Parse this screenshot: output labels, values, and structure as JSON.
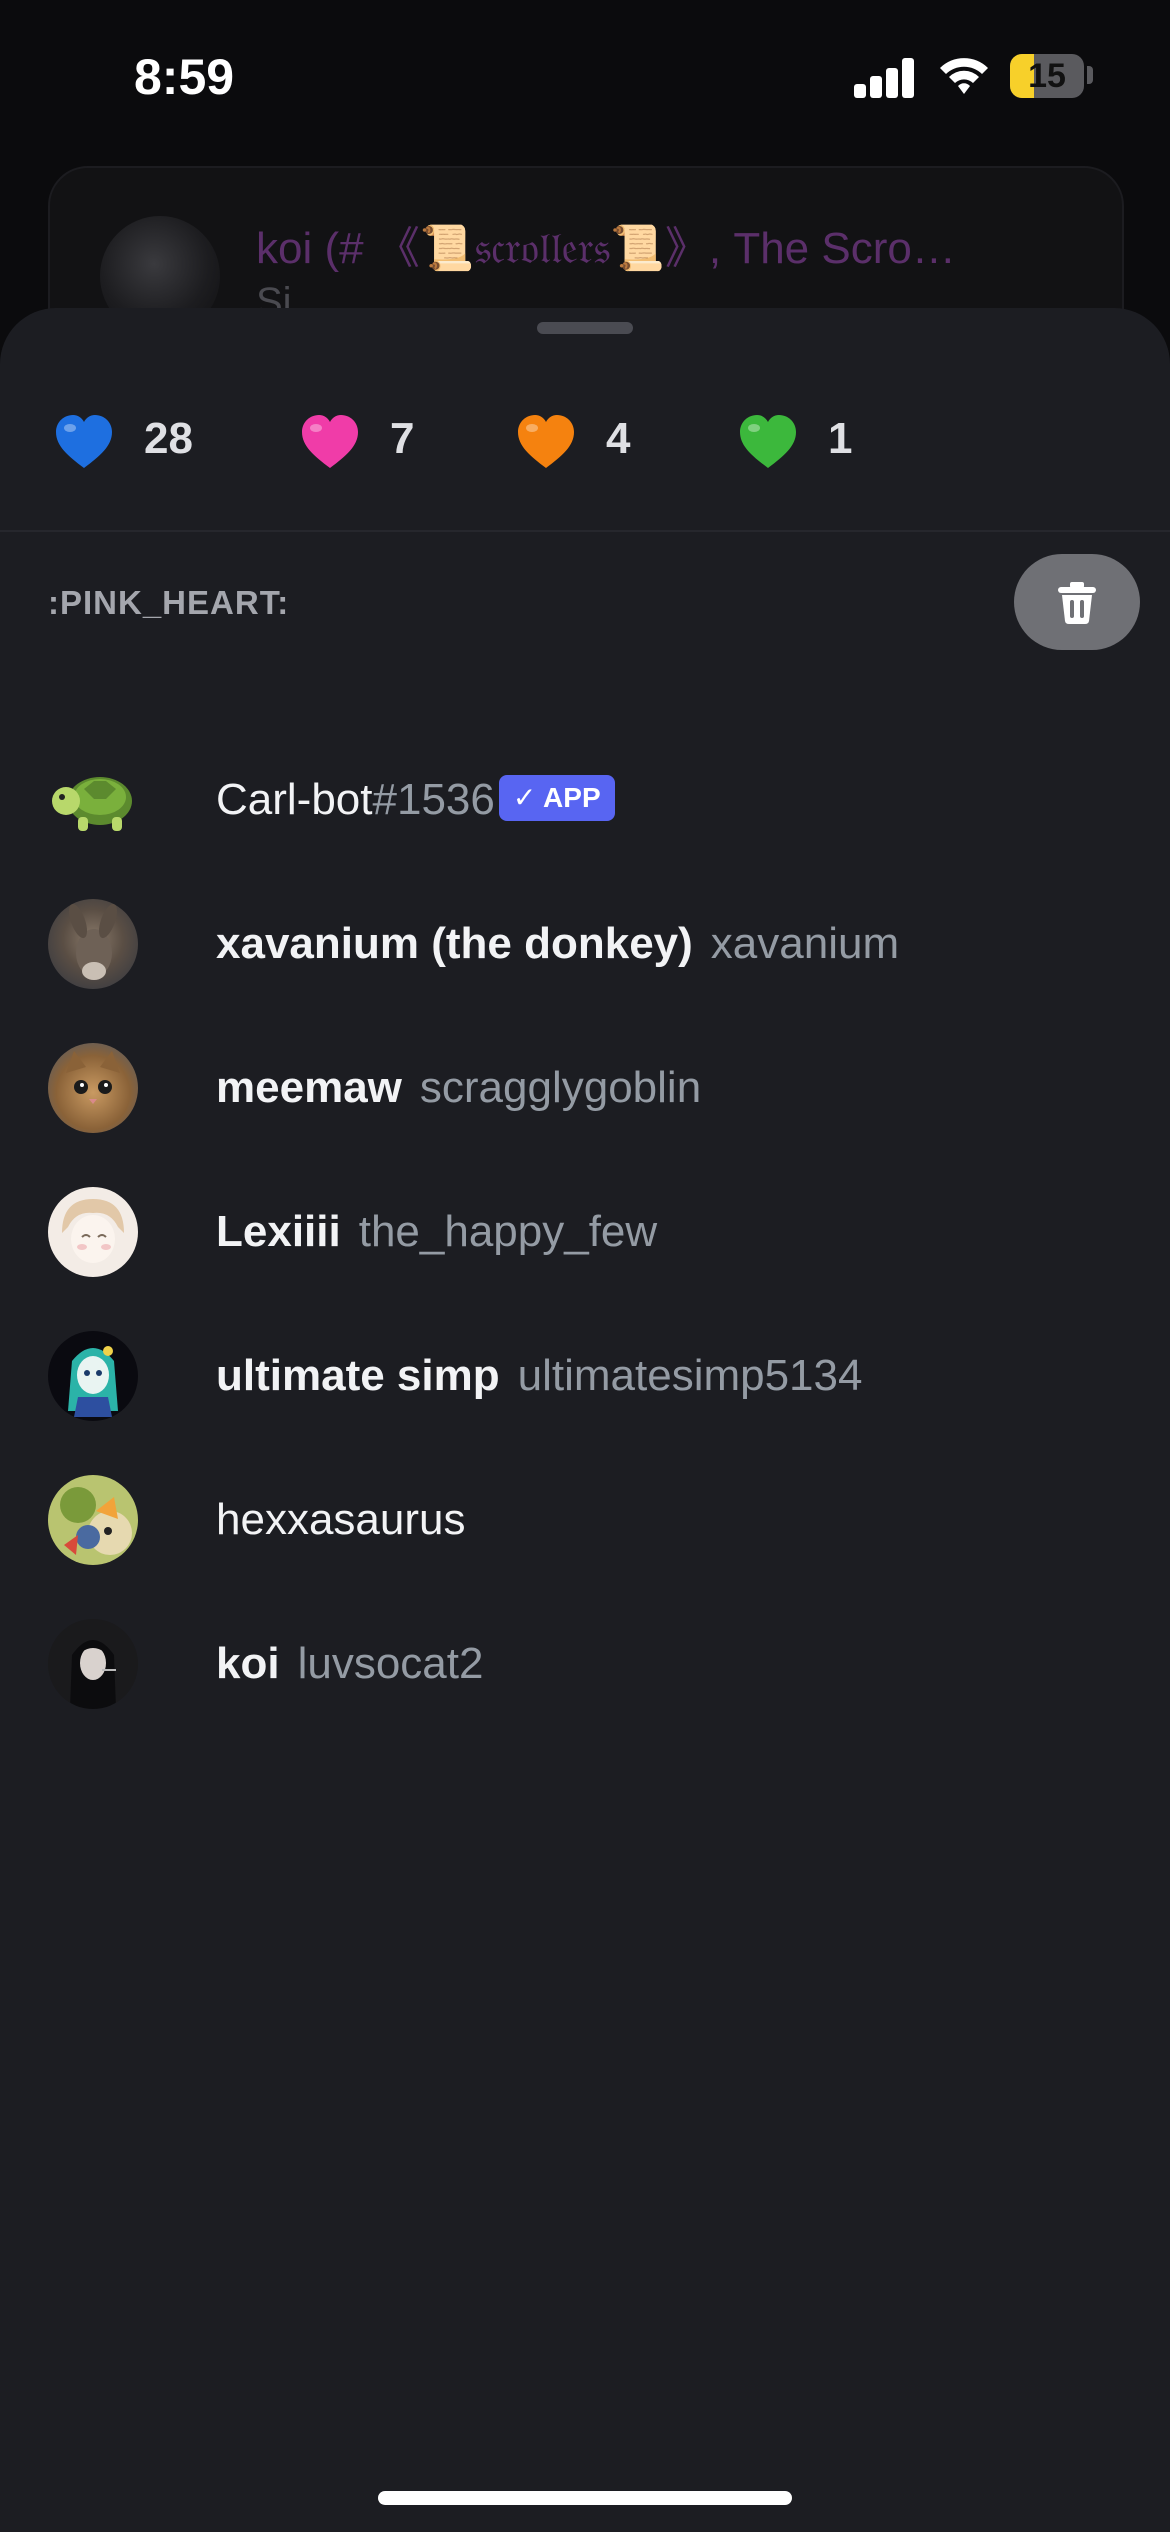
{
  "status_bar": {
    "time": "8:59",
    "battery_level": "15",
    "battery_fraction": 0.15
  },
  "background_message": {
    "title": "koi (# 《📜𝔰𝔠𝔯𝔬𝔩𝔩𝔢𝔯𝔰📜》, The Scro…",
    "preview": "Si"
  },
  "reactions": [
    {
      "emoji": "blue-heart",
      "color": "#1e6fe0",
      "count": "28",
      "selected": false
    },
    {
      "emoji": "pink-heart",
      "color": "#f03ca8",
      "count": "7",
      "selected": true
    },
    {
      "emoji": "orange-heart",
      "color": "#f5820f",
      "count": "4",
      "selected": false
    },
    {
      "emoji": "green-heart",
      "color": "#3cb83c",
      "count": "1",
      "selected": false
    }
  ],
  "selected_reaction_name": ":PINK_HEART:",
  "users": [
    {
      "display_name": "Carl-bot",
      "username": "#1536",
      "badge": "✓ APP",
      "avatar": "turtle"
    },
    {
      "display_name": "xavanium (the donkey)",
      "username": "xavanium",
      "avatar": "donkey"
    },
    {
      "display_name": "meemaw",
      "username": "scragglygoblin",
      "avatar": "cat"
    },
    {
      "display_name": "Lexiiii",
      "username": "the_happy_few",
      "avatar": "anime-light"
    },
    {
      "display_name": "ultimate simp",
      "username": "ultimatesimp5134",
      "avatar": "anime-teal"
    },
    {
      "display_name": "hexxasaurus",
      "username": "",
      "avatar": "art-colorful"
    },
    {
      "display_name": "koi",
      "username": "luvsocat2",
      "avatar": "dark-portrait"
    }
  ],
  "colors": {
    "sheet_bg": "#1c1d22",
    "accent": "#5865f2"
  }
}
